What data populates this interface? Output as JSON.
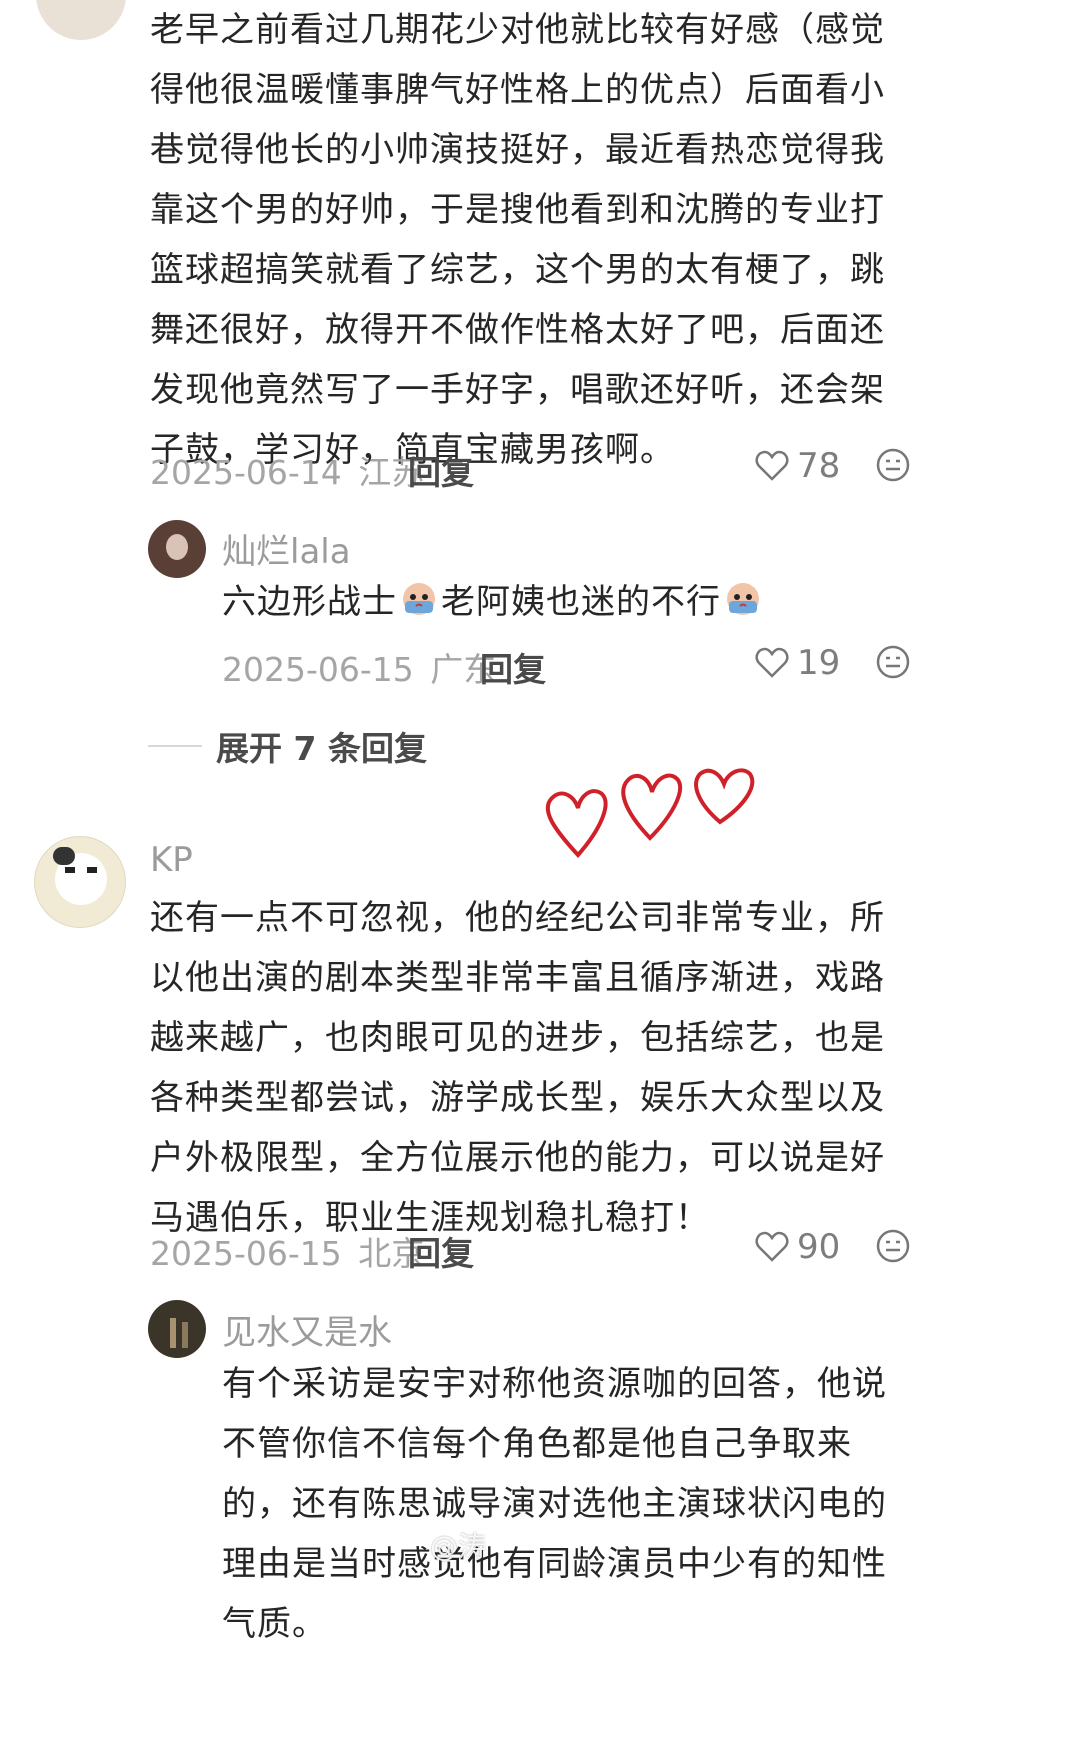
{
  "comments": [
    {
      "text": "老早之前看过几期花少对他就比较有好感（感觉得他很温暖懂事脾气好性格上的优点）后面看小巷觉得他长的小帅演技挺好，最近看热恋觉得我靠这个男的好帅，于是搜他看到和沈腾的专业打篮球超搞笑就看了综艺，这个男的太有梗了，跳舞还很好，放得开不做作性格太好了吧，后面还发现他竟然写了一手好字，唱歌还好听，还会架子鼓，学习好，简直宝藏男孩啊。",
      "date": "2025-06-14",
      "location": "江苏",
      "reply_label": "回复",
      "likes": "78",
      "icons": {
        "like": "heart-outline-icon",
        "react": "smiley-face-icon"
      }
    },
    {
      "username": "灿烂lala",
      "text_part1": "六边形战士",
      "text_part2": "老阿姨也迷的不行",
      "emoji": "crying-emoji",
      "date": "2025-06-15",
      "location": "广东",
      "reply_label": "回复",
      "likes": "19"
    },
    {
      "expand_label": "展开 7 条回复"
    },
    {
      "username": "KP",
      "text": "还有一点不可忽视，他的经纪公司非常专业，所以他出演的剧本类型非常丰富且循序渐进，戏路越来越广，也肉眼可见的进步，包括综艺，也是各种类型都尝试，游学成长型，娱乐大众型以及户外极限型，全方位展示他的能力，可以说是好马遇伯乐，职业生涯规划稳扎稳打！",
      "date": "2025-06-15",
      "location": "北京",
      "reply_label": "回复",
      "likes": "90"
    },
    {
      "username": "见水又是水",
      "text": "有个采访是安宇对称他资源咖的回答，他说不管你信不信每个角色都是他自己争取来的，还有陈思诚导演对选他主演球状闪电的理由是当时感觉他有同龄演员中少有的知性气质。"
    }
  ],
  "watermark": "@涛",
  "decoration": {
    "hearts": "three-hand-drawn-red-hearts",
    "color": "#d0212a"
  }
}
